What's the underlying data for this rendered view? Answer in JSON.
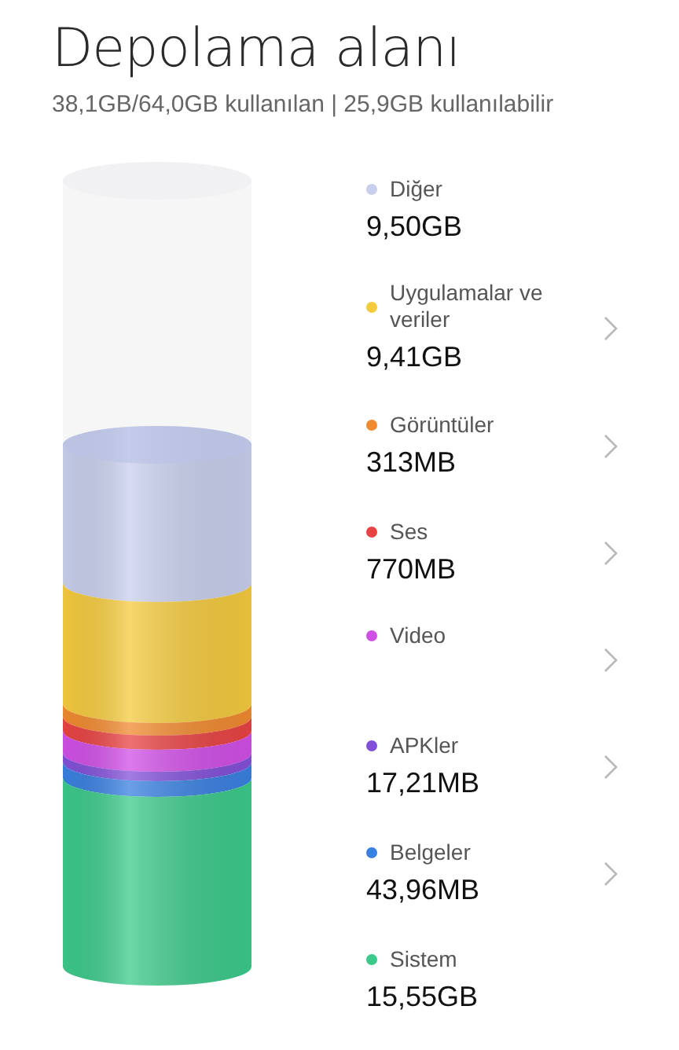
{
  "title": "Depolama alanı",
  "summary": "38,1GB/64,0GB kullanılan | 25,9GB kullanılabilir",
  "categories": [
    {
      "label": "Diğer",
      "size": "9,50GB",
      "color": "#c8cfec",
      "has_arrow": false
    },
    {
      "label": "Uygulamalar ve veriler",
      "size": "9,41GB",
      "color": "#f4ca3e",
      "has_arrow": true
    },
    {
      "label": "Görüntüler",
      "size": "313MB",
      "color": "#f08a30",
      "has_arrow": true
    },
    {
      "label": "Ses",
      "size": "770MB",
      "color": "#e84343",
      "has_arrow": true
    },
    {
      "label": "Video",
      "color": "#d04fe6",
      "has_arrow": true
    },
    {
      "label": "APKler",
      "size": "17,21MB",
      "color": "#8250d8",
      "has_arrow": true
    },
    {
      "label": "Belgeler",
      "size": "43,96MB",
      "color": "#3a80e0",
      "has_arrow": true
    },
    {
      "label": "Sistem",
      "size": "15,55GB",
      "color": "#3cc98a",
      "has_arrow": false
    }
  ]
}
